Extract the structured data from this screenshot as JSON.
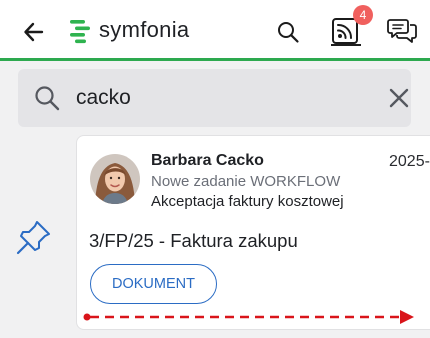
{
  "appbar": {
    "logo_text": "symfonia",
    "feed_badge_count": "4",
    "icons": {
      "back": "arrow-left-icon",
      "search": "search-icon",
      "feed": "feed-icon",
      "chat": "chat-icon"
    },
    "accent_color": "#2da94f"
  },
  "search": {
    "value": "cacko",
    "icons": {
      "search": "search-icon",
      "clear": "close-icon"
    }
  },
  "card": {
    "sender_name": "Barbara Cacko",
    "date": "2025-",
    "task_type": "Nowe zadanie WORKFLOW",
    "task_name": "Akceptacja faktury kosztowej",
    "document_title": "3/FP/25 - Faktura zakupu",
    "document_button": "DOKUMENT",
    "pin_icon": "pin-icon",
    "link_color": "#2b6cc4"
  },
  "swipe_hint": {
    "icon": "swipe-right-arrow-icon",
    "color": "#d9141a"
  }
}
